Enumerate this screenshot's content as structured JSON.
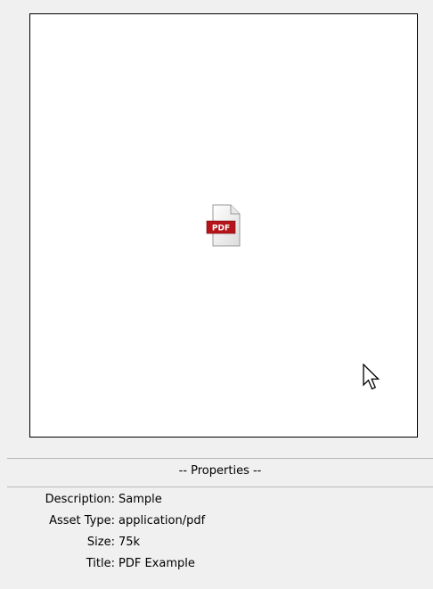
{
  "preview": {
    "file_icon": "pdf-file-icon",
    "file_icon_label": "PDF",
    "pointer": "mouse-pointer-icon"
  },
  "properties": {
    "header": "-- Properties --",
    "rows": [
      {
        "label": "Description:",
        "value": "Sample"
      },
      {
        "label": "Asset Type:",
        "value": "application/pdf"
      },
      {
        "label": "Size:",
        "value": "75k"
      },
      {
        "label": "Title:",
        "value": "PDF Example"
      }
    ]
  },
  "colors": {
    "panel_background": "#f0f0f0",
    "preview_background": "#ffffff",
    "pdf_badge": "#b5141b"
  }
}
